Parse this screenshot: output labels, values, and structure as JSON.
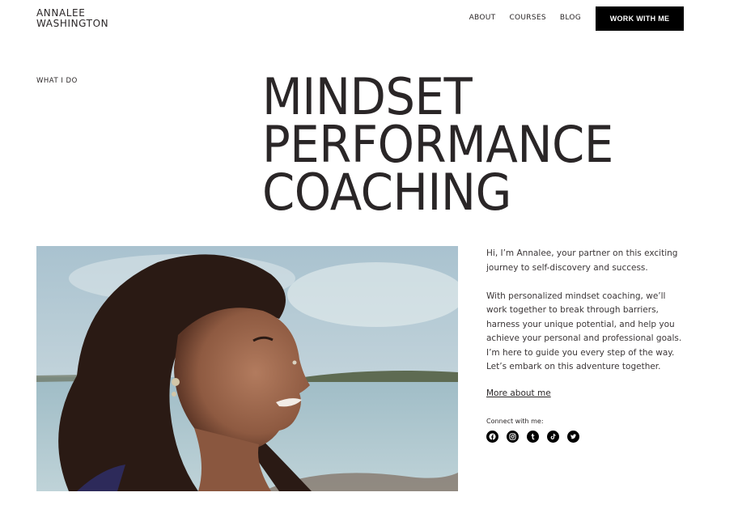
{
  "brand": {
    "line1": "ANNALEE",
    "line2": "WASHINGTON"
  },
  "nav": {
    "items": [
      {
        "label": "ABOUT"
      },
      {
        "label": "COURSES"
      },
      {
        "label": "BLOG"
      }
    ],
    "cta": "WORK WITH ME"
  },
  "hero": {
    "eyebrow": "WHAT I DO",
    "title_lines": [
      "MINDSET",
      "PERFORMANCE",
      "COACHING"
    ]
  },
  "bio": {
    "paragraph1": "Hi, I’m Annalee, your partner on this exciting journey to self-discovery and success.",
    "paragraph2": "With personalized mindset coaching, we’ll work together to break through barriers, harness your unique potential, and help you achieve your personal and professional goals. I’m here to guide you every step of the way. Let’s embark on this adventure together.",
    "more_link": "More about me"
  },
  "social": {
    "label": "Connect with me:",
    "icons": [
      "facebook-icon",
      "instagram-icon",
      "tumblr-icon",
      "tiktok-icon",
      "twitter-icon"
    ]
  },
  "colors": {
    "text": "#2a2627",
    "cta_bg": "#000000",
    "background": "#ffffff"
  }
}
